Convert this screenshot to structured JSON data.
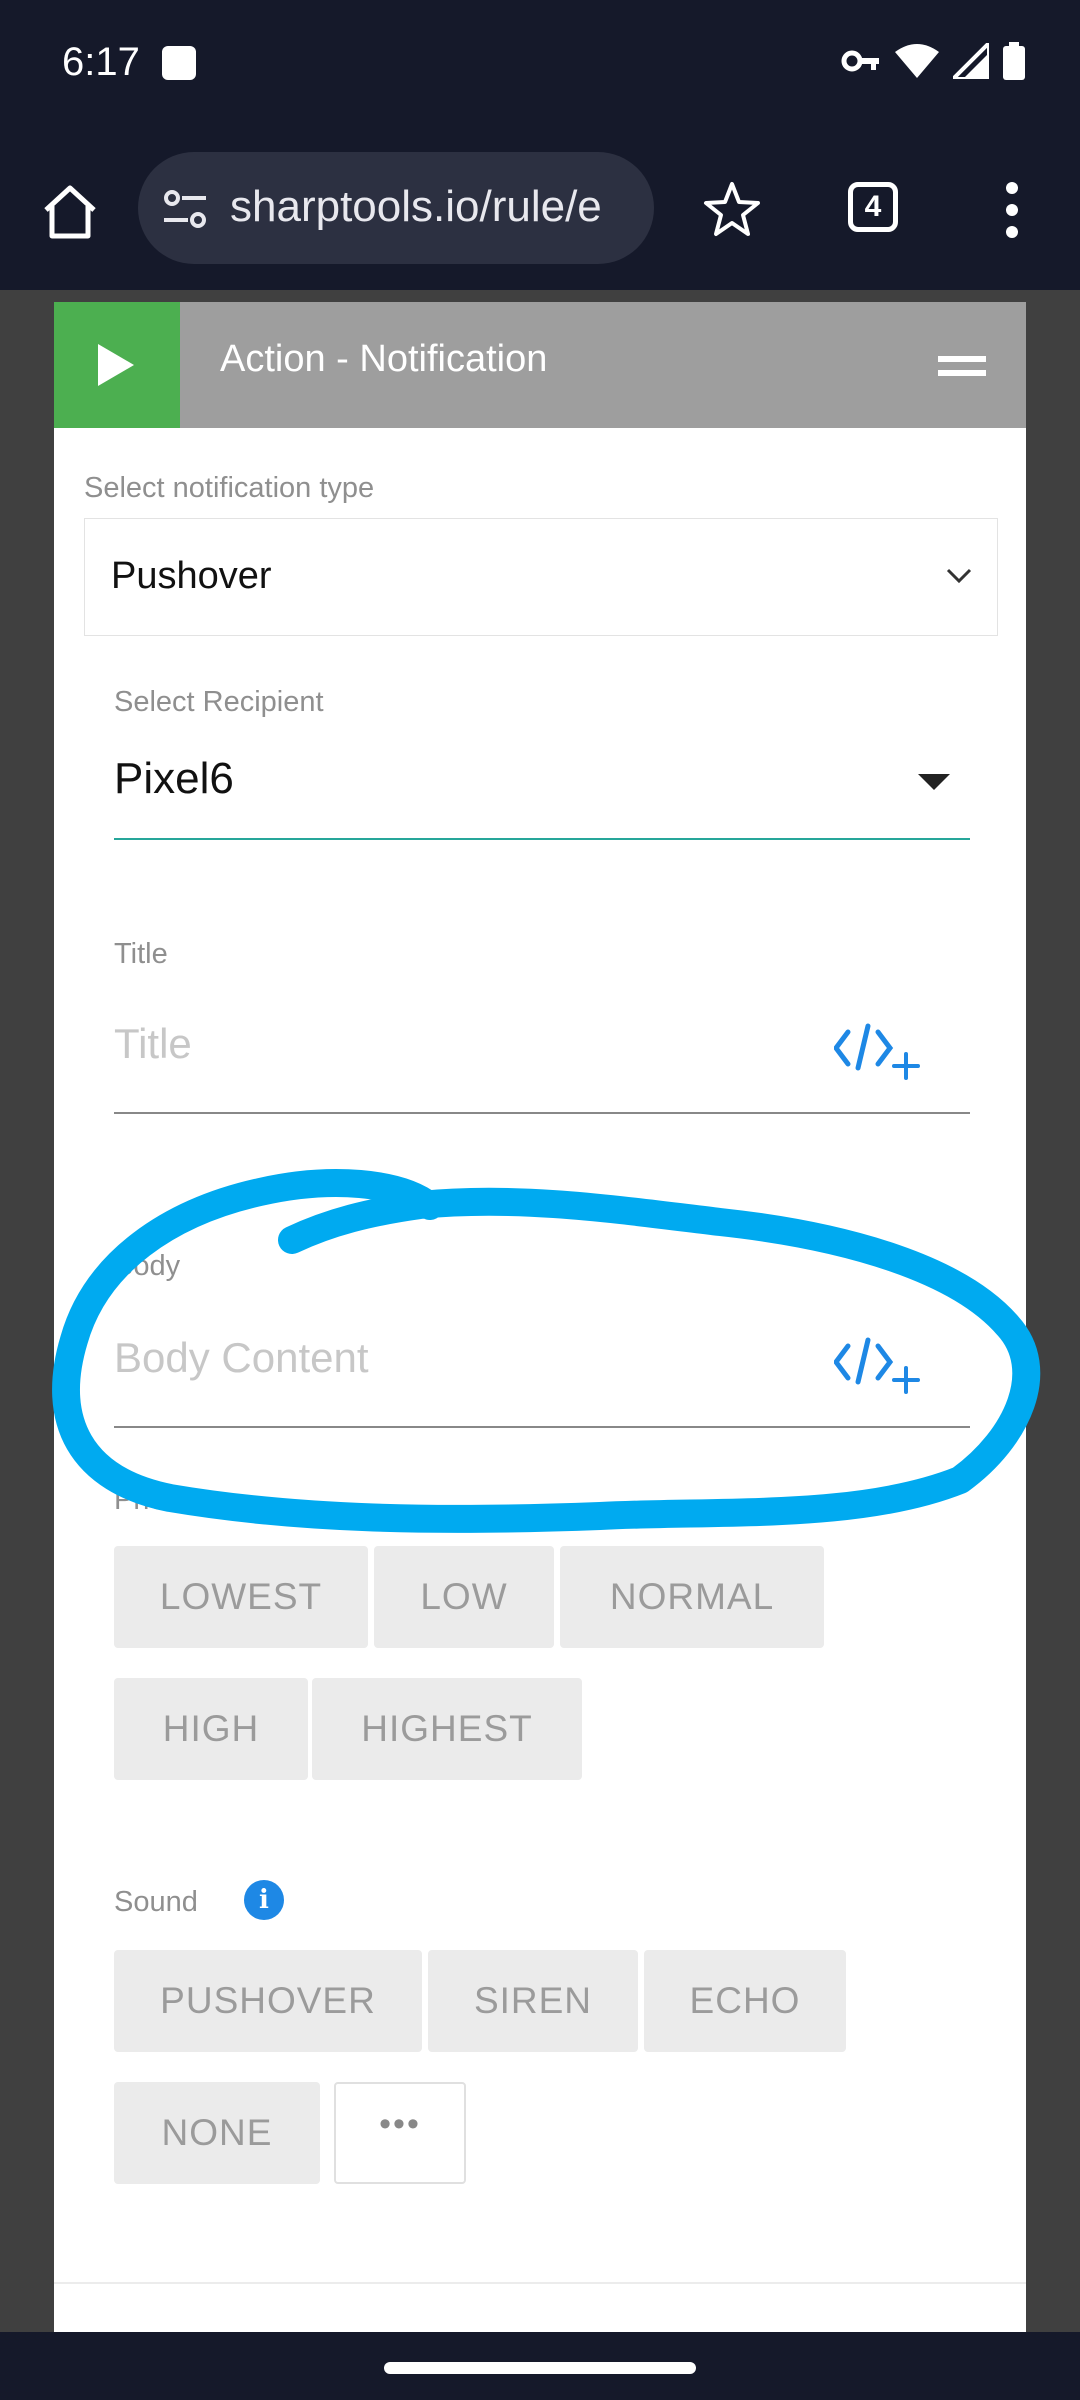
{
  "status_bar": {
    "time": "6:17"
  },
  "browser": {
    "url": "sharptools.io/rule/e",
    "tab_count": "4"
  },
  "card": {
    "title": "Action - Notification",
    "notification_type": {
      "label": "Select notification type",
      "value": "Pushover"
    },
    "recipient": {
      "label": "Select Recipient",
      "value": "Pixel6"
    },
    "title_field": {
      "label": "Title",
      "placeholder": "Title"
    },
    "body_field": {
      "label": "Body",
      "placeholder": "Body Content"
    },
    "priority": {
      "label": "Priority",
      "options": [
        "LOWEST",
        "LOW",
        "NORMAL",
        "HIGH",
        "HIGHEST"
      ]
    },
    "sound": {
      "label": "Sound",
      "options": [
        "PUSHOVER",
        "SIREN",
        "ECHO",
        "NONE"
      ],
      "more_label": "•••"
    }
  },
  "colors": {
    "status_bar_bg": "#15192a",
    "header_bg": "#9e9e9e",
    "play_green": "#4caf50",
    "accent_teal": "#26a69a",
    "code_icon_blue": "#1e88e5",
    "annotation_blue": "#00aaf0"
  }
}
